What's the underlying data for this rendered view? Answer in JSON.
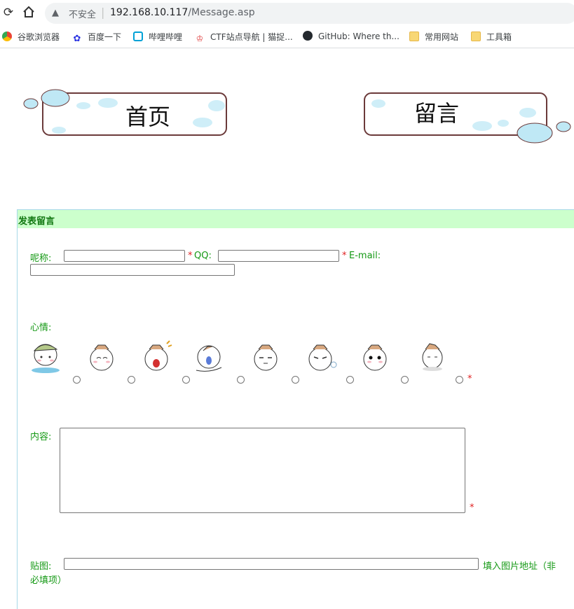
{
  "browser": {
    "insecure_label": "不安全",
    "url_host": "192.168.10.117",
    "url_path": "/Message.asp"
  },
  "bookmarks": [
    {
      "label": "谷歌浏览器",
      "icon": "chrome-icon"
    },
    {
      "label": "百度一下",
      "icon": "baidu-icon"
    },
    {
      "label": "哔哩哔哩",
      "icon": "bilibili-icon"
    },
    {
      "label": "CTF站点导航 | 猫捉...",
      "icon": "ctf-icon"
    },
    {
      "label": "GitHub: Where th...",
      "icon": "github-icon"
    },
    {
      "label": "常用网站",
      "icon": "folder-icon"
    },
    {
      "label": "工具箱",
      "icon": "folder-icon"
    }
  ],
  "banner": {
    "home_label": "首页",
    "message_label": "留言"
  },
  "form": {
    "title": "发表留言",
    "nickname_label": "呢称:",
    "qq_label": "QQ:",
    "email_label": "E-mail:",
    "required_mark": "*",
    "mood_label": "心情:",
    "content_label": "内容:",
    "image_label": "贴图:",
    "image_hint_line1": "填入图片地址（非",
    "image_hint_line2": "必填项）"
  },
  "colors": {
    "label_green": "#159915",
    "header_bg": "#ccffcc",
    "required_red": "#e02020"
  }
}
